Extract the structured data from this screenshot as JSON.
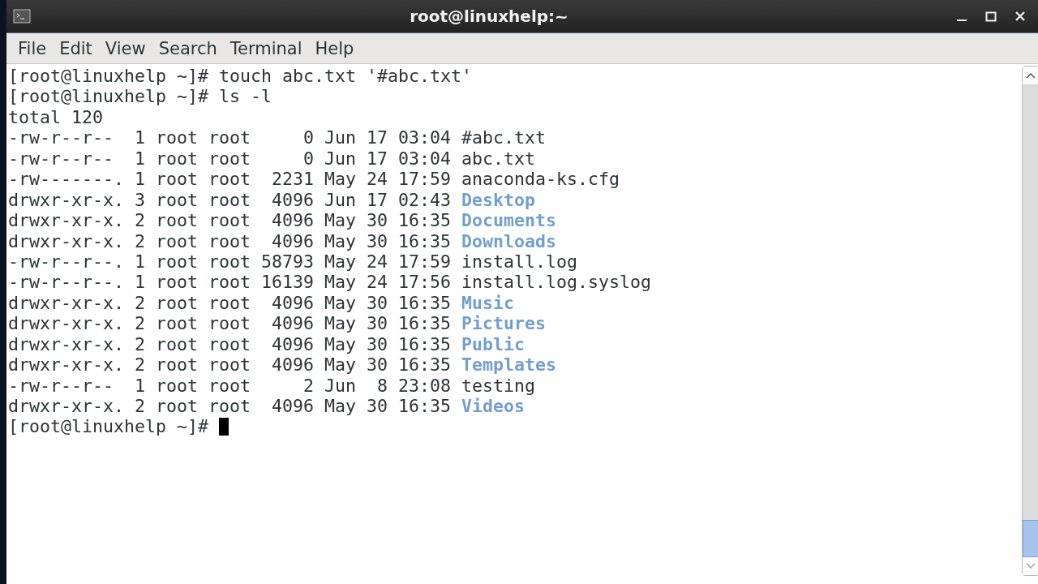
{
  "window": {
    "title": "root@linuxhelp:~"
  },
  "menu": [
    "File",
    "Edit",
    "View",
    "Search",
    "Terminal",
    "Help"
  ],
  "terminal": {
    "lines": [
      {
        "kind": "text",
        "text": "[root@linuxhelp ~]# touch abc.txt '#abc.txt'"
      },
      {
        "kind": "text",
        "text": "[root@linuxhelp ~]# ls -l"
      },
      {
        "kind": "text",
        "text": "total 120"
      },
      {
        "kind": "entry",
        "info": "-rw-r--r--  1 root root     0 Jun 17 03:04",
        "name": "#abc.txt",
        "directory": false
      },
      {
        "kind": "entry",
        "info": "-rw-r--r--  1 root root     0 Jun 17 03:04",
        "name": "abc.txt",
        "directory": false
      },
      {
        "kind": "entry",
        "info": "-rw-------. 1 root root  2231 May 24 17:59",
        "name": "anaconda-ks.cfg",
        "directory": false
      },
      {
        "kind": "entry",
        "info": "drwxr-xr-x. 3 root root  4096 Jun 17 02:43",
        "name": "Desktop",
        "directory": true
      },
      {
        "kind": "entry",
        "info": "drwxr-xr-x. 2 root root  4096 May 30 16:35",
        "name": "Documents",
        "directory": true
      },
      {
        "kind": "entry",
        "info": "drwxr-xr-x. 2 root root  4096 May 30 16:35",
        "name": "Downloads",
        "directory": true
      },
      {
        "kind": "entry",
        "info": "-rw-r--r--. 1 root root 58793 May 24 17:59",
        "name": "install.log",
        "directory": false
      },
      {
        "kind": "entry",
        "info": "-rw-r--r--. 1 root root 16139 May 24 17:56",
        "name": "install.log.syslog",
        "directory": false
      },
      {
        "kind": "entry",
        "info": "drwxr-xr-x. 2 root root  4096 May 30 16:35",
        "name": "Music",
        "directory": true
      },
      {
        "kind": "entry",
        "info": "drwxr-xr-x. 2 root root  4096 May 30 16:35",
        "name": "Pictures",
        "directory": true
      },
      {
        "kind": "entry",
        "info": "drwxr-xr-x. 2 root root  4096 May 30 16:35",
        "name": "Public",
        "directory": true
      },
      {
        "kind": "entry",
        "info": "drwxr-xr-x. 2 root root  4096 May 30 16:35",
        "name": "Templates",
        "directory": true
      },
      {
        "kind": "entry",
        "info": "-rw-r--r--  1 root root     2 Jun  8 23:08",
        "name": "testing",
        "directory": false
      },
      {
        "kind": "entry",
        "info": "drwxr-xr-x. 2 root root  4096 May 30 16:35",
        "name": "Videos",
        "directory": true
      },
      {
        "kind": "prompt",
        "text": "[root@linuxhelp ~]# "
      }
    ]
  }
}
